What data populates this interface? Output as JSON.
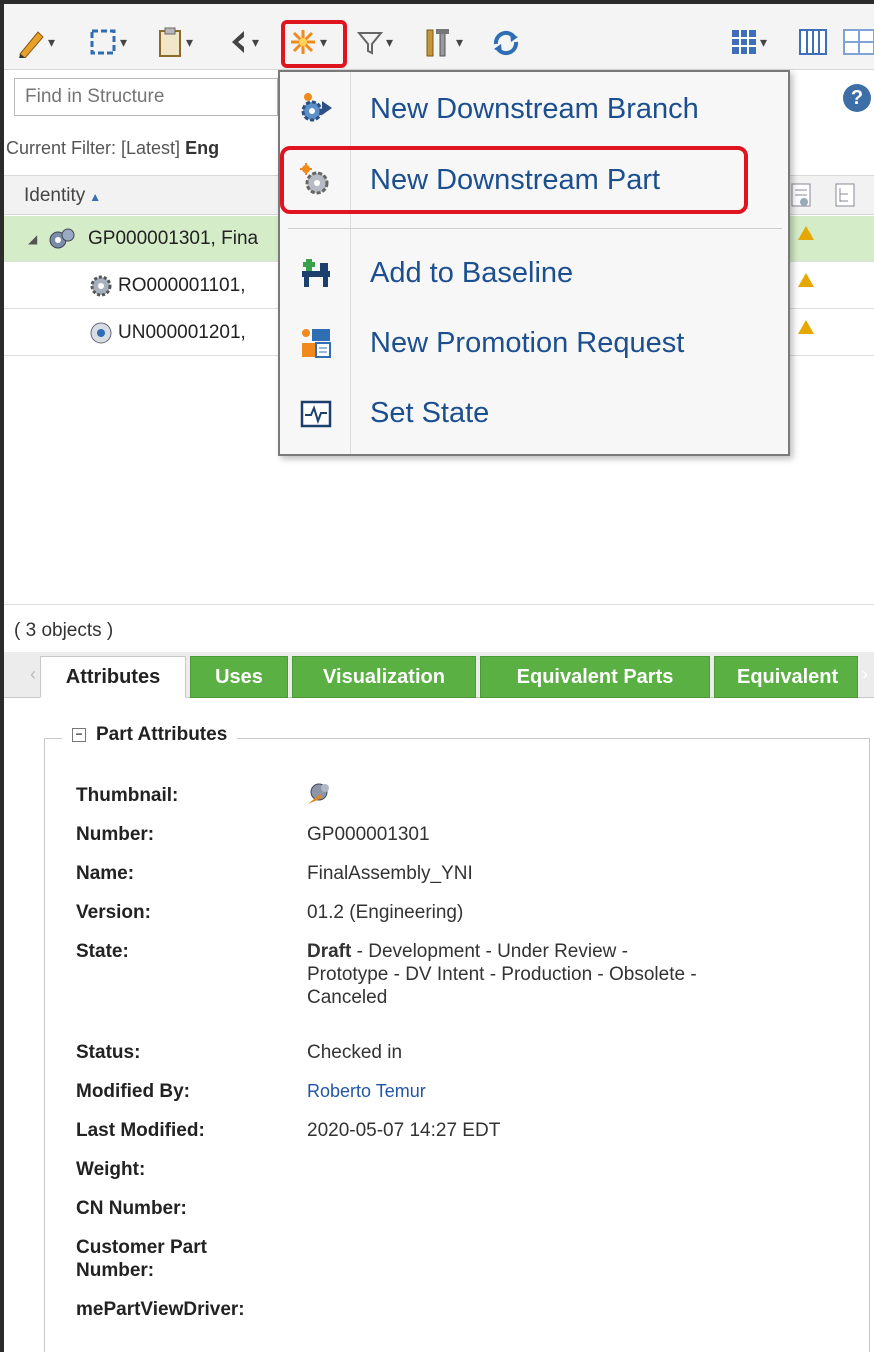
{
  "toolbar": {
    "items": [
      "edit-menu",
      "select-menu",
      "paste-menu",
      "back-menu",
      "new-menu",
      "filter-menu",
      "tools-menu",
      "refresh"
    ]
  },
  "search": {
    "placeholder": "Find in Structure"
  },
  "filter": {
    "prefix": "Current Filter: [Latest] ",
    "bold": "Eng"
  },
  "table": {
    "column_identity": "Identity",
    "rows": [
      {
        "label": "GP000001301, Fina",
        "selected": true
      },
      {
        "label": "RO000001101,",
        "selected": false
      },
      {
        "label": "UN000001201,",
        "selected": false
      }
    ]
  },
  "object_count": "( 3 objects )",
  "tabs": [
    "Attributes",
    "Uses",
    "Visualization",
    "Equivalent Parts",
    "Equivalent"
  ],
  "attributes": {
    "section_title": "Part Attributes",
    "labels": {
      "thumbnail": "Thumbnail:",
      "number": "Number:",
      "name": "Name:",
      "version": "Version:",
      "state": "State:",
      "status": "Status:",
      "modified_by": "Modified By:",
      "last_modified": "Last Modified:",
      "weight": "Weight:",
      "cn_number": "CN Number:",
      "customer_part_1": "Customer Part",
      "customer_part_2": "Number:",
      "me_part_view_driver": "mePartViewDriver:"
    },
    "values": {
      "number": "GP000001301",
      "name": "FinalAssembly_YNI",
      "version": "01.2 (Engineering)",
      "state_current": "Draft",
      "state_rest_1": " - Development - Under Review -",
      "state_rest_2": "Prototype - DV Intent - Production - Obsolete -",
      "state_rest_3": "Canceled",
      "status": "Checked in",
      "modified_by": "Roberto Temur",
      "last_modified": "2020-05-07 14:27 EDT"
    }
  },
  "menu": {
    "items": [
      {
        "label": "New Downstream Branch",
        "icon": "gear-arrow-icon"
      },
      {
        "label": "New Downstream Part",
        "icon": "gear-star-icon",
        "highlighted": true
      },
      {
        "label": "Add to Baseline",
        "icon": "baseline-icon"
      },
      {
        "label": "New Promotion Request",
        "icon": "promotion-icon"
      },
      {
        "label": "Set State",
        "icon": "set-state-icon"
      }
    ]
  },
  "colors": {
    "tab_green": "#5bb043",
    "selected_row": "#d5ecc8",
    "highlight_red": "#e0141e",
    "menu_text": "#1c4f8f"
  }
}
